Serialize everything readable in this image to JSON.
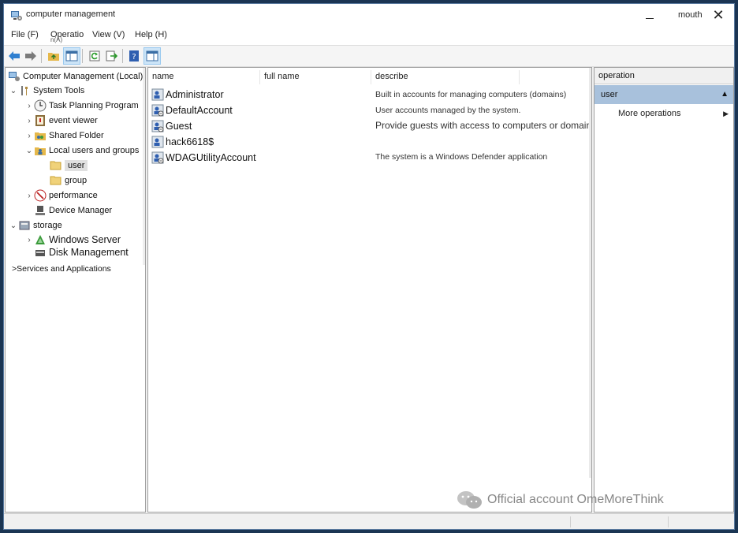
{
  "window": {
    "title": "computer management",
    "maximize_label": "mouth",
    "close_glyph": "✕"
  },
  "menu": {
    "items": [
      "File (F)",
      "Operatio",
      "View (V)",
      "Help (H)"
    ],
    "operation_hint": "n(A)"
  },
  "toolbar": {
    "icons": [
      "back-arrow-icon",
      "forward-arrow-icon",
      "up-folder-icon",
      "show-hide-tree-icon",
      "refresh-icon",
      "export-list-icon",
      "help-icon",
      "show-action-pane-icon"
    ]
  },
  "tree": {
    "root": "Computer Management (Local)",
    "system_tools": "System Tools",
    "task_scheduler": "Task Planning Program",
    "event_viewer": "event viewer",
    "shared_folder": "Shared Folder",
    "local_users": "Local users and groups",
    "user": "user",
    "group": "group",
    "performance": "performance",
    "device_manager": "Device Manager",
    "storage": "storage",
    "windows_server": "Windows Server",
    "disk_management": "Disk Management",
    "services": ">Services and Applications"
  },
  "columns": {
    "name": "name",
    "full_name": "full name",
    "describe": "describe"
  },
  "users": [
    {
      "name": "Administrator",
      "description": "Built in accounts for managing computers (domains)"
    },
    {
      "name": "DefaultAccount",
      "description": "User accounts managed by the system."
    },
    {
      "name": "Guest",
      "description": "Provide guests with access to computers or domains within"
    },
    {
      "name": "hack6618$",
      "description": ""
    },
    {
      "name": "WDAGUtilityAccount",
      "description": "The system is a Windows Defender application"
    }
  ],
  "operations": {
    "header": "operation",
    "section": "user",
    "more": "More operations"
  },
  "watermark": "Official account OmeMoreThink",
  "colors": {
    "selection_blue": "#a8c1dc",
    "background": "#1b3553"
  }
}
